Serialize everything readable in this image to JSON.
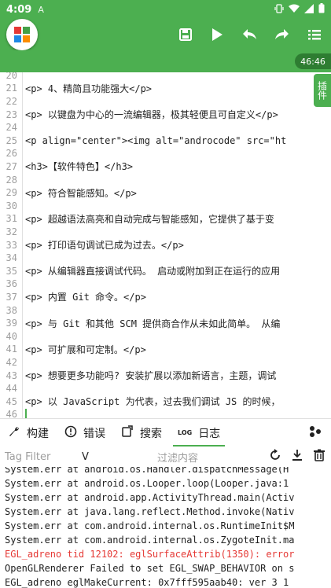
{
  "status": {
    "time": "4:09",
    "sim_icon": "A"
  },
  "toolbar": {
    "logo": "app-logo"
  },
  "editor_time": "46:46",
  "side_tab": "插件",
  "editor": {
    "lines": [
      {
        "n": "20",
        "t": ""
      },
      {
        "n": "21",
        "t": "<p>    4、精简且功能强大</p>"
      },
      {
        "n": "22",
        "t": ""
      },
      {
        "n": "23",
        "t": "<p>    以键盘为中心的一流编辑器，极其轻便且可自定义</p>"
      },
      {
        "n": "24",
        "t": ""
      },
      {
        "n": "25",
        "t": "<p align=\"center\"><img alt=\"androcode\" src=\"ht"
      },
      {
        "n": "26",
        "t": ""
      },
      {
        "n": "27",
        "t": "<h3>【软件特色】</h3>"
      },
      {
        "n": "28",
        "t": ""
      },
      {
        "n": "29",
        "t": "<p>    符合智能感知。</p>"
      },
      {
        "n": "30",
        "t": ""
      },
      {
        "n": "31",
        "t": "<p>    超越语法高亮和自动完成与智能感知，它提供了基于变"
      },
      {
        "n": "32",
        "t": ""
      },
      {
        "n": "33",
        "t": "<p>    打印语句调试已成为过去。</p>"
      },
      {
        "n": "34",
        "t": ""
      },
      {
        "n": "35",
        "t": "<p>    从编辑器直接调试代码。 启动或附加到正在运行的应用"
      },
      {
        "n": "36",
        "t": ""
      },
      {
        "n": "37",
        "t": "<p>    内置 Git 命令。</p>"
      },
      {
        "n": "38",
        "t": ""
      },
      {
        "n": "39",
        "t": "<p>    与 Git 和其他 SCM 提供商合作从未如此简单。 从编"
      },
      {
        "n": "40",
        "t": ""
      },
      {
        "n": "41",
        "t": "<p>    可扩展和可定制。</p>"
      },
      {
        "n": "42",
        "t": ""
      },
      {
        "n": "43",
        "t": "<p>    想要更多功能吗? 安装扩展以添加新语言，主题，调试"
      },
      {
        "n": "44",
        "t": ""
      },
      {
        "n": "45",
        "t": "<p>    以 JavaScript 为代表，过去我们调试 JS 的时候，"
      },
      {
        "n": "46",
        "t": ""
      }
    ]
  },
  "tabs": [
    {
      "icon": "wrench-icon",
      "label": "构建"
    },
    {
      "icon": "error-icon",
      "label": "错误"
    },
    {
      "icon": "search-icon",
      "label": "搜索"
    },
    {
      "icon": "log-icon",
      "label": "日志",
      "badge": "LOG"
    }
  ],
  "filter": {
    "tag_placeholder": "Tag Filter",
    "level": "V",
    "content_placeholder": "过滤内容"
  },
  "log": [
    {
      "t": "System.err   at android.os.Handler.dispatchMessage(H",
      "c": "#212121"
    },
    {
      "t": "System.err   at android.os.Looper.loop(Looper.java:1",
      "c": "#212121"
    },
    {
      "t": "System.err   at android.app.ActivityThread.main(Activ",
      "c": "#212121"
    },
    {
      "t": "System.err   at java.lang.reflect.Method.invoke(Nativ",
      "c": "#212121"
    },
    {
      "t": "System.err   at com.android.internal.os.RuntimeInit$M",
      "c": "#212121"
    },
    {
      "t": "System.err   at com.android.internal.os.ZygoteInit.ma",
      "c": "#212121"
    },
    {
      "t": "EGL_adreno  tid 12102: eglSurfaceAttrib(1350): error",
      "c": "#e53935"
    },
    {
      "t": "OpenGLRenderer  Failed to set EGL_SWAP_BEHAVIOR on s",
      "c": "#212121"
    },
    {
      "t": "EGL_adreno  eglMakeCurrent: 0x7fff595aab40: ver 3 1",
      "c": "#212121"
    }
  ],
  "colors": {
    "accent": "#4caf50",
    "error": "#e53935"
  }
}
